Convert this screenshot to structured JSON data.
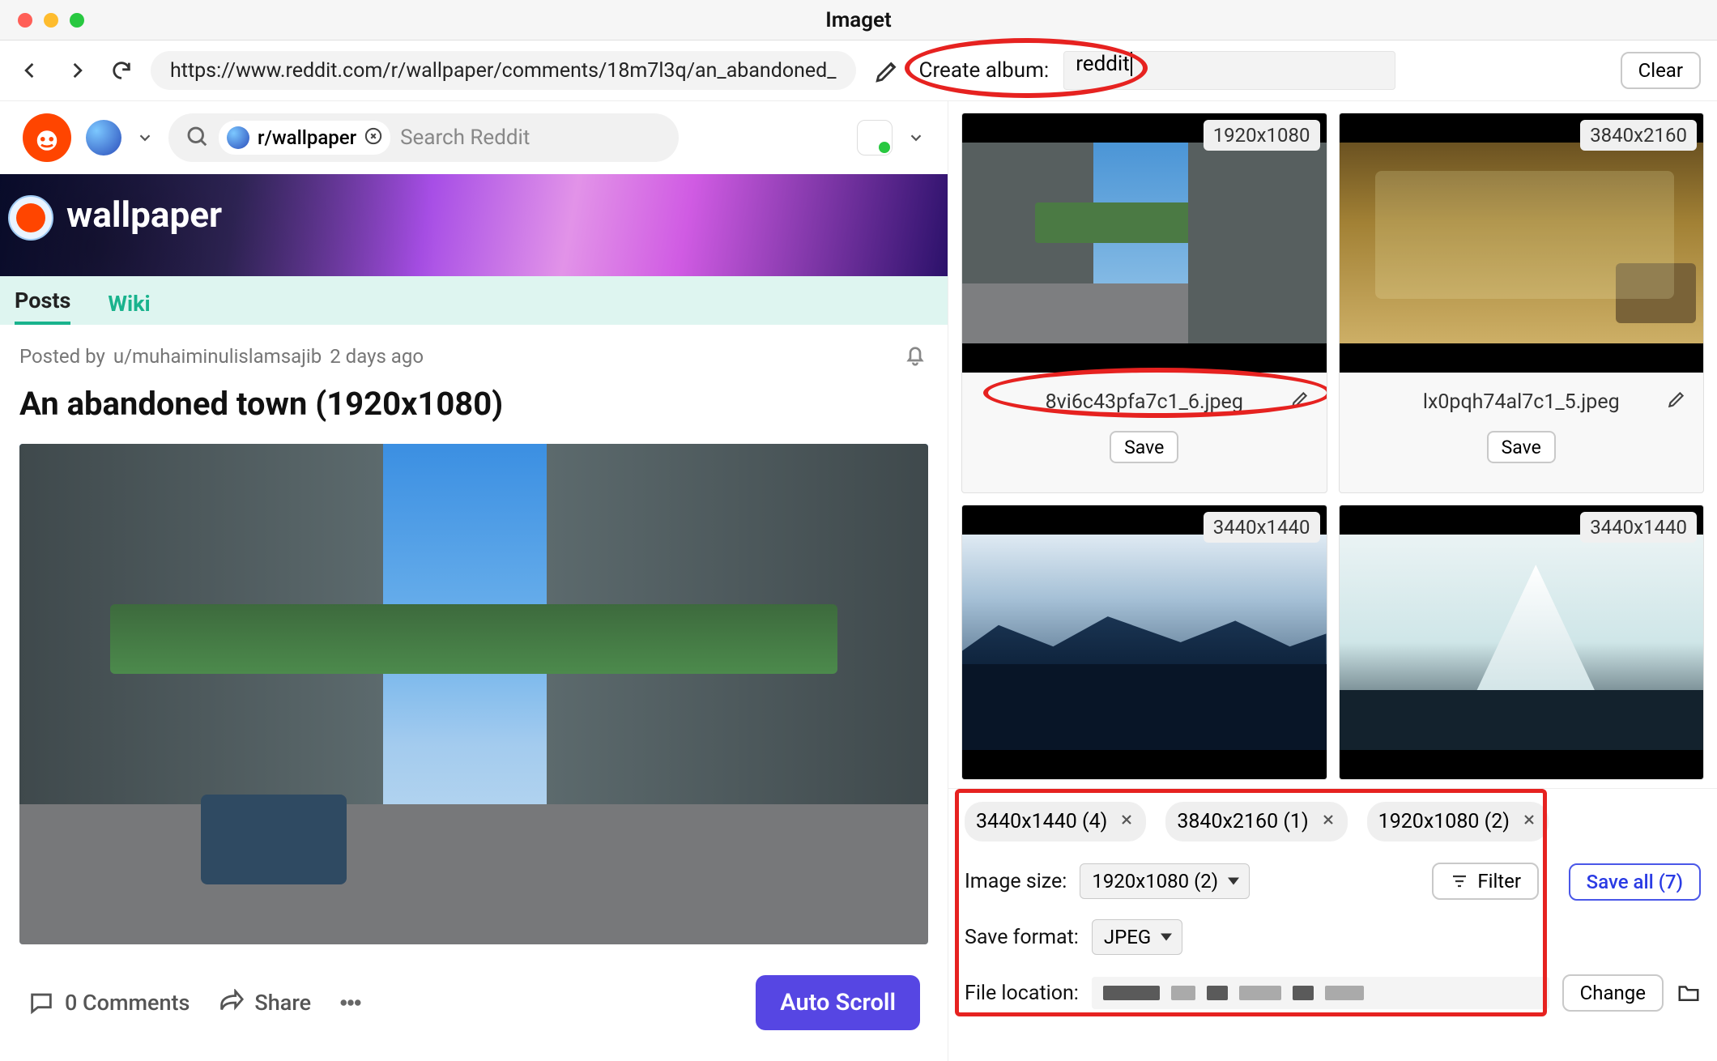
{
  "window": {
    "title": "Imaget"
  },
  "toolbar": {
    "url": "https://www.reddit.com/r/wallpaper/comments/18m7l3q/an_abandoned_",
    "album_label": "Create album:",
    "album_value": "reddit",
    "clear": "Clear"
  },
  "reddit": {
    "search_chip": "r/wallpaper",
    "search_placeholder": "Search Reddit",
    "banner_title": "wallpaper",
    "tabs": [
      {
        "label": "Posts",
        "active": true
      },
      {
        "label": "Wiki",
        "active": false
      }
    ],
    "posted_by_prefix": "Posted by ",
    "author": "u/muhaiminulislamsajib",
    "age": "2 days ago",
    "post_title": "An abandoned town (1920x1080)",
    "comments": "0 Comments",
    "share": "Share",
    "autoscroll": "Auto Scroll"
  },
  "thumbs": [
    {
      "res": "1920x1080",
      "filename": "8vi6c43pfa7c1_6.jpeg",
      "save": "Save"
    },
    {
      "res": "3840x2160",
      "filename": "lx0pqh74al7c1_5.jpeg",
      "save": "Save"
    },
    {
      "res": "3440x1440"
    },
    {
      "res": "3440x1440"
    }
  ],
  "filters": {
    "chips": [
      "3440x1440 (4)",
      "3840x2160 (1)",
      "1920x1080 (2)"
    ],
    "image_size_label": "Image size:",
    "image_size_value": "1920x1080 (2)",
    "filter_label": "Filter",
    "save_all": "Save all (7)",
    "save_format_label": "Save format:",
    "save_format_value": "JPEG",
    "file_location_label": "File location:",
    "change": "Change"
  }
}
